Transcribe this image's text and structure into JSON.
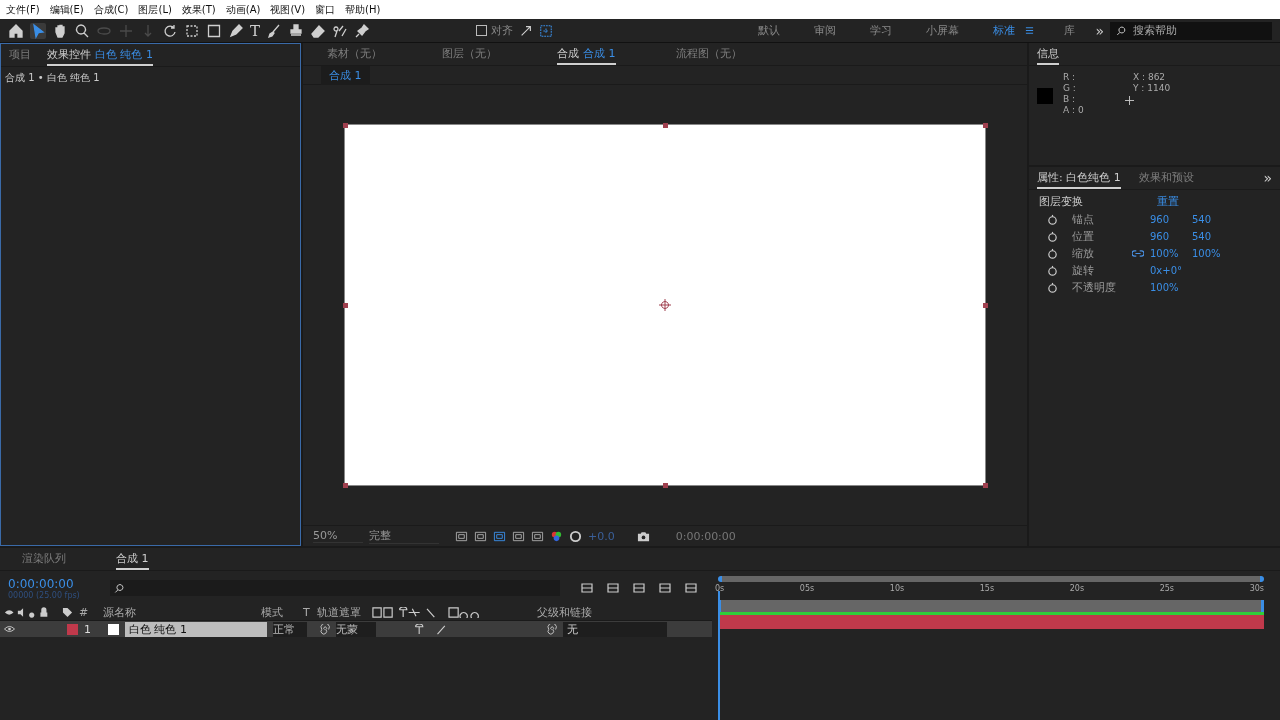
{
  "menu": [
    "文件(F)",
    "编辑(E)",
    "合成(C)",
    "图层(L)",
    "效果(T)",
    "动画(A)",
    "视图(V)",
    "窗口",
    "帮助(H)"
  ],
  "toolbar": {
    "tools": [
      {
        "kind": "home",
        "selected": false,
        "disabled": false
      },
      {
        "kind": "pointer",
        "selected": true,
        "disabled": false
      },
      {
        "kind": "hand",
        "selected": false,
        "disabled": false
      },
      {
        "kind": "zoom",
        "selected": false,
        "disabled": false
      },
      {
        "kind": "orbit",
        "selected": false,
        "disabled": true
      },
      {
        "kind": "pan",
        "selected": false,
        "disabled": true
      },
      {
        "kind": "dolly",
        "selected": false,
        "disabled": true
      },
      {
        "kind": "rotate",
        "selected": false,
        "disabled": false
      },
      {
        "kind": "region",
        "selected": false,
        "disabled": false
      },
      {
        "kind": "rect",
        "selected": false,
        "disabled": false
      },
      {
        "kind": "pen",
        "selected": false,
        "disabled": false
      },
      {
        "kind": "text",
        "glyph": "T",
        "selected": false,
        "disabled": false
      },
      {
        "kind": "brush",
        "selected": false,
        "disabled": false
      },
      {
        "kind": "stamp",
        "selected": false,
        "disabled": false
      },
      {
        "kind": "eraser",
        "selected": false,
        "disabled": false
      },
      {
        "kind": "roto",
        "selected": false,
        "disabled": false
      },
      {
        "kind": "pin",
        "selected": false,
        "disabled": false
      }
    ],
    "snap": {
      "label": "对齐",
      "checked": false
    },
    "workspaces": [
      {
        "label": "默认",
        "selected": false
      },
      {
        "label": "审阅",
        "selected": false
      },
      {
        "label": "学习",
        "selected": false
      },
      {
        "label": "小屏幕",
        "selected": false
      },
      {
        "label": "标准",
        "selected": true
      },
      {
        "label": "库",
        "selected": false
      }
    ],
    "overflow": "»",
    "search": {
      "placeholder": "搜索帮助"
    }
  },
  "left_panel": {
    "tabs": [
      {
        "label": "项目",
        "selected": false
      },
      {
        "label": "效果控件",
        "target": "白色 纯色 1",
        "selected": true
      }
    ],
    "breadcrumb": "合成 1 • 白色 纯色 1"
  },
  "viewer": {
    "tabs": [
      {
        "label": "素材（无）",
        "selected": false
      },
      {
        "label": "图层（无）",
        "selected": false
      },
      {
        "label": "合成",
        "target": "合成 1",
        "selected": true
      },
      {
        "label": "流程图（无）",
        "selected": false
      }
    ],
    "subtab": "合成 1",
    "zoom": "50%",
    "resolution": "完整",
    "exposure": "+0.0",
    "timecode": "0:00:00:00"
  },
  "info": {
    "tab": "信息",
    "channels": [
      "R :",
      "G :",
      "B :",
      "A : 0"
    ],
    "coords": [
      "X : 862",
      "Y : 1140"
    ]
  },
  "properties": {
    "tabs": [
      {
        "label": "属性: 白色纯色 1",
        "selected": true
      },
      {
        "label": "效果和预设",
        "selected": false
      }
    ],
    "overflow": "»",
    "section": "图层变换",
    "reset": "重置",
    "rows": [
      {
        "name": "锚点",
        "values": [
          "960",
          "540"
        ],
        "linked": false
      },
      {
        "name": "位置",
        "values": [
          "960",
          "540"
        ],
        "linked": false
      },
      {
        "name": "缩放",
        "values": [
          "100%",
          "100%"
        ],
        "linked": true
      },
      {
        "name": "旋转",
        "values": [
          "0x+0°"
        ],
        "linked": false
      },
      {
        "name": "不透明度",
        "values": [
          "100%"
        ],
        "linked": false
      }
    ]
  },
  "timeline": {
    "tabs": [
      {
        "label": "渲染队列",
        "selected": false
      },
      {
        "label": "合成 1",
        "selected": true
      }
    ],
    "timecode": "0:00:00:00",
    "frame_info": "00000 (25.00 fps)",
    "columns": {
      "number": "#",
      "source": "源名称",
      "mode": "模式",
      "t": "T",
      "matte": "轨道遮罩",
      "parent": "父级和链接"
    },
    "layers": [
      {
        "number": "1",
        "name": "白色 纯色 1",
        "mode": "正常",
        "matte": "无蒙",
        "parent": "无",
        "color": "#c0394b",
        "visible": true,
        "selected": true
      }
    ],
    "ruler": [
      "0s",
      "05s",
      "10s",
      "15s",
      "20s",
      "25s",
      "30s"
    ]
  }
}
